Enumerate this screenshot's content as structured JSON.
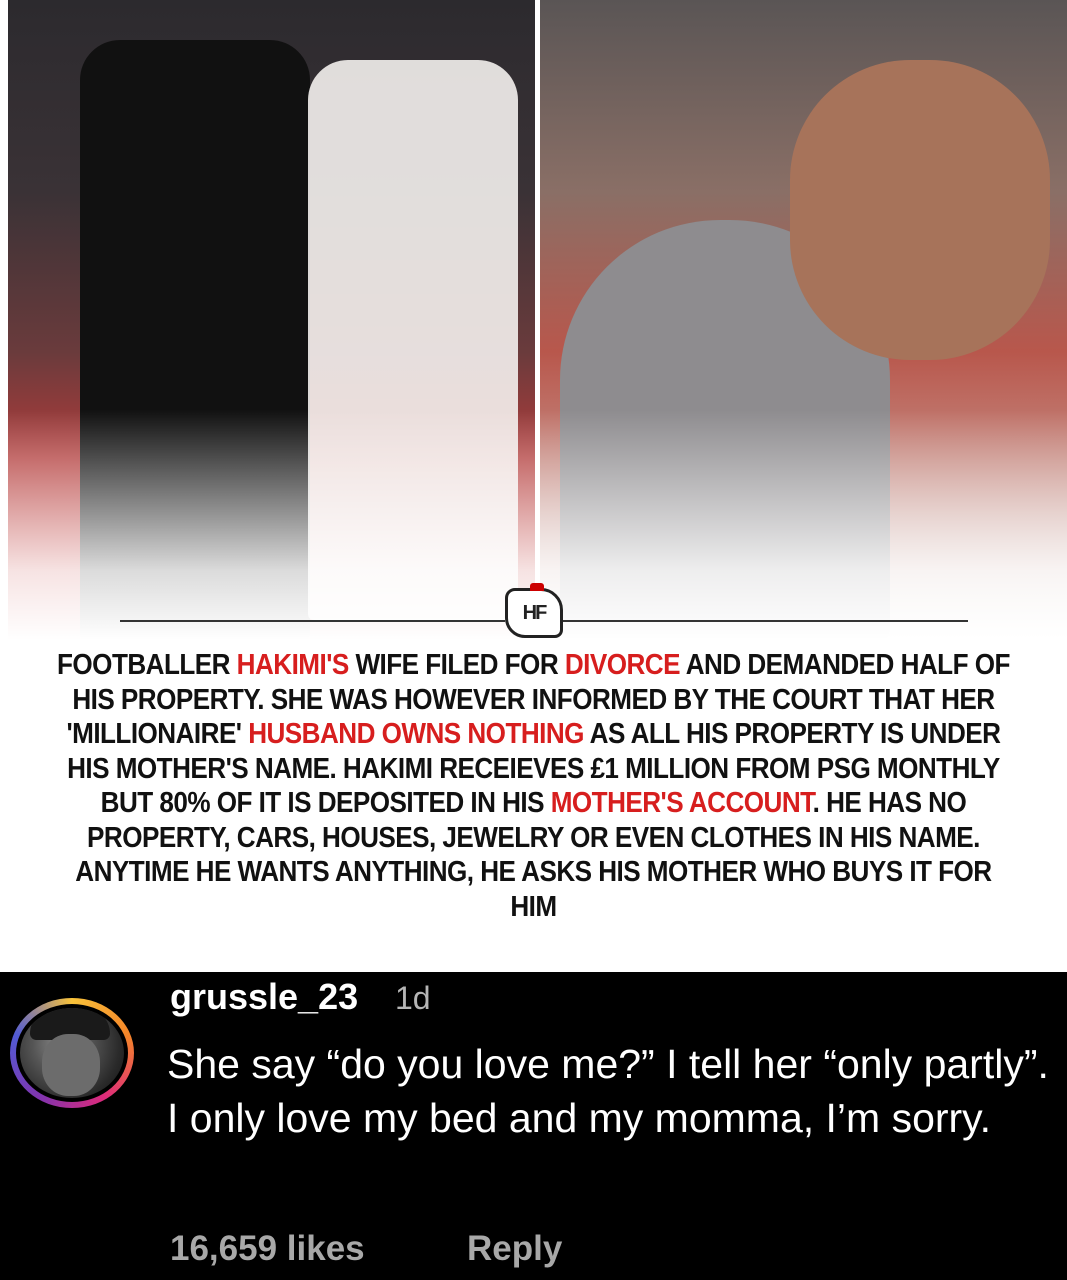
{
  "post": {
    "headline_segments": [
      {
        "text": "Footballer ",
        "highlight": false
      },
      {
        "text": "Hakimi's",
        "highlight": true
      },
      {
        "text": " wife filed for ",
        "highlight": false
      },
      {
        "text": "divorce",
        "highlight": true
      },
      {
        "text": " and demanded half of his property. She was however informed by the court that her 'millionaire' ",
        "highlight": false
      },
      {
        "text": "husband owns nothing",
        "highlight": true
      },
      {
        "text": " as all his property is under his mother's name. Hakimi receieves £1 million from PSG monthly but 80% of it is deposited in his ",
        "highlight": false
      },
      {
        "text": "mother's account",
        "highlight": true
      },
      {
        "text": ". He has no property, cars, houses, jewelry or even clothes in his name. Anytime he wants anything, he asks his mother who buys it for him",
        "highlight": false
      }
    ],
    "highlight_color": "#d71e1e",
    "logo_icon": "brand-logo-icon"
  },
  "comment": {
    "username": "grussle_23",
    "time": "1d",
    "text": "She say “do you love me?” I tell her “only partly”. I only love my bed and my momma, I’m sorry.",
    "likes": "16,659 likes",
    "reply_label": "Reply",
    "avatar_icon": "avatar-icon"
  }
}
